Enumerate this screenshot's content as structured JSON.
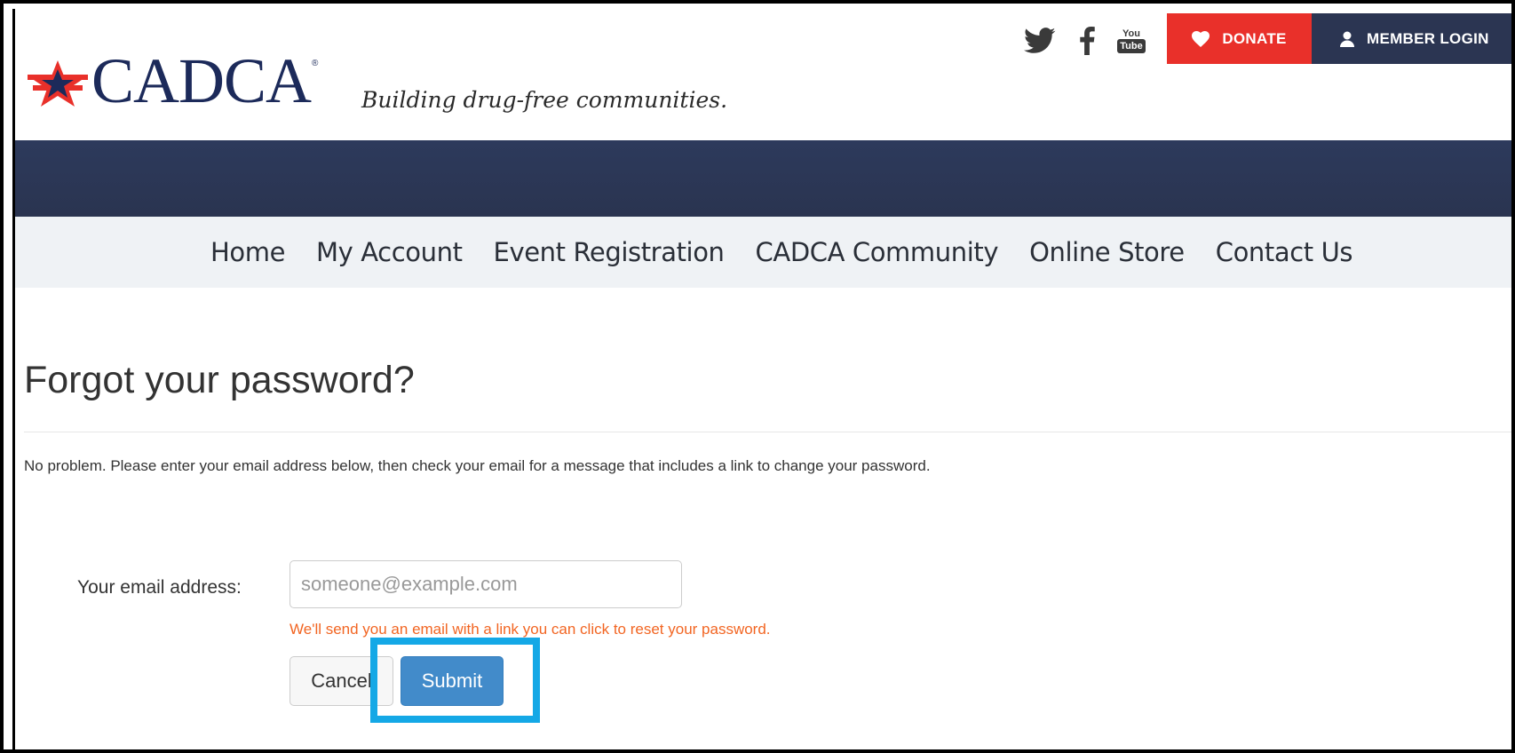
{
  "header": {
    "logo_text": "CADCA",
    "logo_registered": "®",
    "tagline": "Building drug-free communities.",
    "social_icons": [
      "twitter-icon",
      "facebook-icon",
      "youtube-icon"
    ],
    "youtube_text_top": "You",
    "youtube_text_bottom": "Tube",
    "donate_label": "DONATE",
    "member_login_label": "MEMBER LOGIN"
  },
  "nav": {
    "items": [
      {
        "label": "Home"
      },
      {
        "label": "My Account"
      },
      {
        "label": "Event Registration"
      },
      {
        "label": "CADCA Community"
      },
      {
        "label": "Online Store"
      },
      {
        "label": "Contact Us"
      }
    ]
  },
  "main": {
    "title": "Forgot your password?",
    "intro": "No problem. Please enter your email address below, then check your email for a message that includes a link to change your password.",
    "email_label": "Your email address:",
    "email_value": "",
    "email_placeholder": "someone@example.com",
    "hint": "We'll send you an email with a link you can click to reset your password.",
    "cancel_label": "Cancel",
    "submit_label": "Submit"
  },
  "colors": {
    "donate": "#e9302a",
    "member_login": "#2b3552",
    "navy_band": "#2d3a5c",
    "nav_bg": "#eff2f5",
    "submit": "#428bca",
    "hint": "#f26522",
    "highlight": "#14a8e6",
    "logo": "#1c2a5a"
  }
}
